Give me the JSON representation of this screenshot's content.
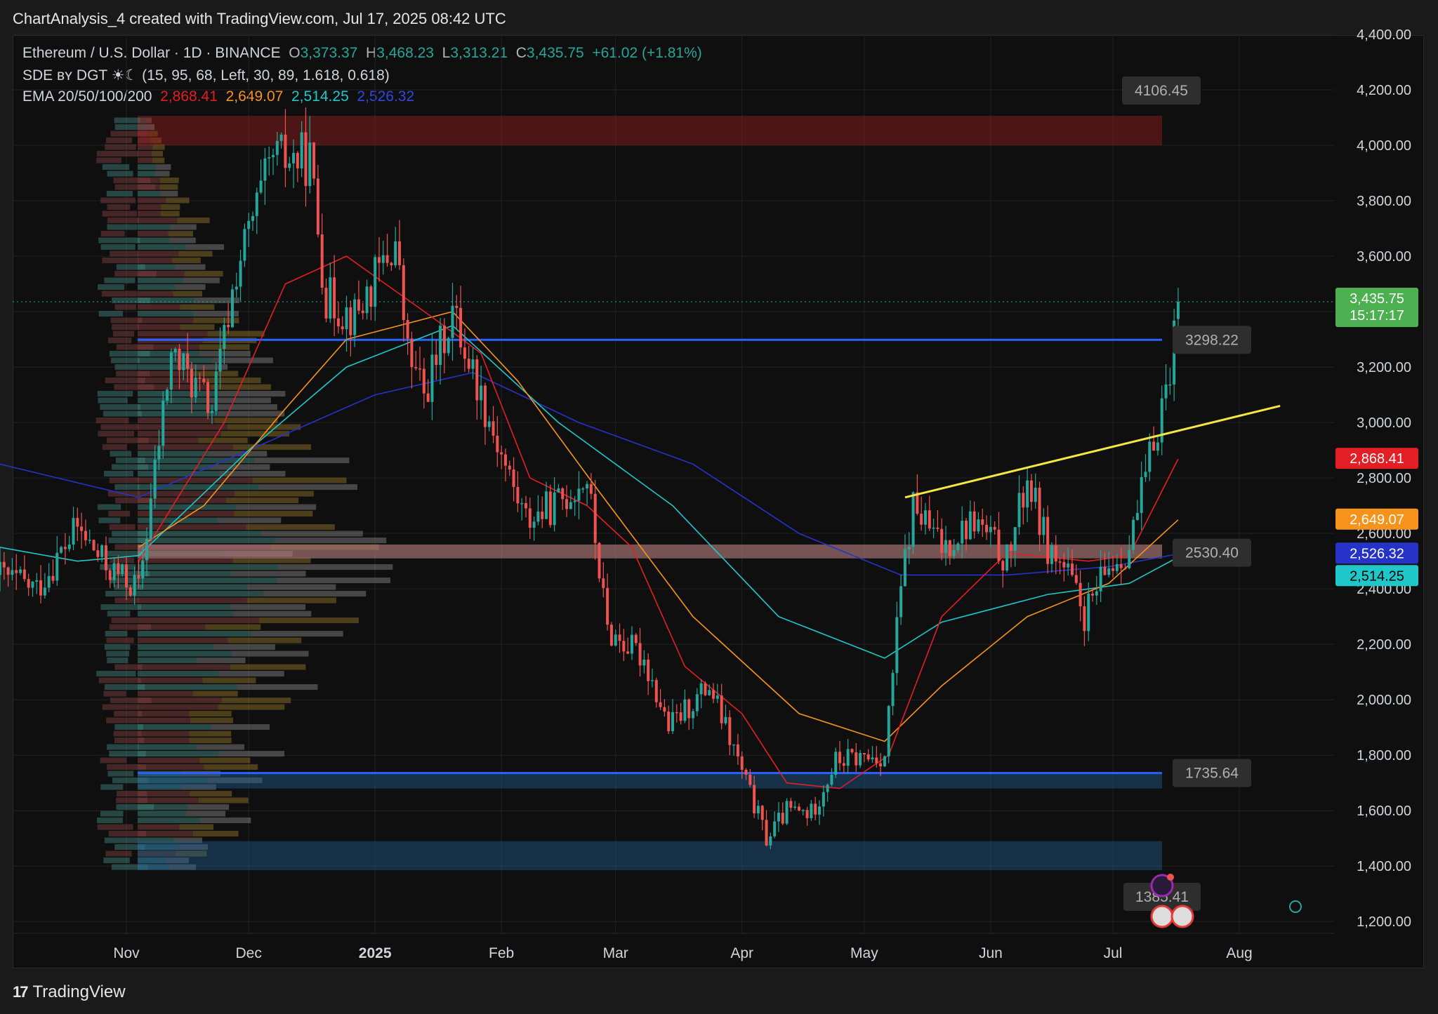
{
  "header": {
    "attribution": "ChartAnalysis_4 created with TradingView.com, Jul 17, 2025 08:42 UTC"
  },
  "legend": {
    "symbol": "Ethereum / U.S. Dollar · 1D · BINANCE",
    "open_label": "O",
    "open": "3,373.37",
    "high_label": "H",
    "high": "3,468.23",
    "low_label": "L",
    "low": "3,313.21",
    "close_label": "C",
    "close": "3,435.75",
    "change": "+61.02 (+1.81%)",
    "sde": "SDE ʙʏ DGT ☀☾ (15, 95, 68, Left, 30, 89, 1.618, 0.618)",
    "ema_label": "EMA 20/50/100/200",
    "ema20": "2,868.41",
    "ema50": "2,649.07",
    "ema100": "2,514.25",
    "ema200": "2,526.32"
  },
  "footer": {
    "brand": "TradingView",
    "logo": "17"
  },
  "colors": {
    "up": "#26a69a",
    "down": "#ef5350",
    "ema20": "#e31e24",
    "ema50": "#f7931a",
    "ema100": "#1ec8c8",
    "ema200": "#2633c9",
    "trendline": "#f5e642",
    "level": "#2962ff"
  },
  "chart_data": {
    "type": "candlestick",
    "title": "Ethereum / U.S. Dollar · 1D · BINANCE",
    "xlabel": "",
    "ylabel": "",
    "ylim": [
      1050,
      4500
    ],
    "x_ticks": [
      {
        "label": "Nov",
        "date": "2024-11-01"
      },
      {
        "label": "Dec",
        "date": "2024-12-01"
      },
      {
        "label": "2025",
        "date": "2025-01-01",
        "bold": true
      },
      {
        "label": "Feb",
        "date": "2025-02-01"
      },
      {
        "label": "Mar",
        "date": "2025-03-01"
      },
      {
        "label": "Apr",
        "date": "2025-04-01"
      },
      {
        "label": "May",
        "date": "2025-05-01"
      },
      {
        "label": "Jun",
        "date": "2025-06-01"
      },
      {
        "label": "Jul",
        "date": "2025-07-01"
      },
      {
        "label": "Aug",
        "date": "2025-08-01"
      }
    ],
    "y_ticks": [
      "1,200.00",
      "1,400.00",
      "1,600.00",
      "1,800.00",
      "2,000.00",
      "2,200.00",
      "2,400.00",
      "2,600.00",
      "2,800.00",
      "3,000.00",
      "3,200.00",
      "3,400.00",
      "3,600.00",
      "3,800.00",
      "4,000.00",
      "4,200.00",
      "4,400.00"
    ],
    "y_tick_values": [
      1200,
      1400,
      1600,
      1800,
      2000,
      2200,
      2400,
      2600,
      2800,
      3000,
      3200,
      3400,
      3600,
      3800,
      4000,
      4200,
      4400
    ],
    "last_price": {
      "value": 3435.75,
      "label": "3,435.75",
      "countdown": "15:17:17"
    },
    "ema_tags": [
      {
        "value": 2868.41,
        "label": "2,868.41",
        "color": "#e31e24"
      },
      {
        "value": 2649.07,
        "label": "2,649.07",
        "color": "#f7931a"
      },
      {
        "value": 2526.32,
        "label": "2,526.32",
        "color": "#2633c9"
      },
      {
        "value": 2514.25,
        "label": "2,514.25",
        "color": "#1ec8c8"
      }
    ],
    "zones": [
      {
        "from": 4000,
        "to": 4106.45,
        "label": "4106.45",
        "color": "red"
      },
      {
        "from": 2510,
        "to": 2560,
        "label": "2530.40",
        "color": "red"
      },
      {
        "from": 1680,
        "to": 1735.64,
        "label": "1735.64",
        "color": "blue"
      },
      {
        "from": 1385.41,
        "to": 1490,
        "label": "1385.41",
        "color": "blue"
      }
    ],
    "levels": [
      {
        "value": 3298.22,
        "label": "3298.22"
      },
      {
        "value": 1735.64,
        "label": "1735.64"
      }
    ],
    "trendline": {
      "start": {
        "date": "2025-05-11",
        "price": 2730
      },
      "end": {
        "date": "2025-08-11",
        "price": 3060
      }
    },
    "price_path": [
      [
        "2024-10-01",
        2450
      ],
      [
        "2024-10-10",
        2400
      ],
      [
        "2024-10-20",
        2620
      ],
      [
        "2024-10-27",
        2480
      ],
      [
        "2024-11-04",
        2400
      ],
      [
        "2024-11-12",
        3250
      ],
      [
        "2024-11-22",
        3050
      ],
      [
        "2024-11-28",
        3550
      ],
      [
        "2024-12-07",
        3950
      ],
      [
        "2024-12-16",
        3950
      ],
      [
        "2024-12-20",
        3450
      ],
      [
        "2024-12-27",
        3380
      ],
      [
        "2025-01-06",
        3650
      ],
      [
        "2025-01-09",
        3250
      ],
      [
        "2025-01-13",
        3100
      ],
      [
        "2025-01-20",
        3400
      ],
      [
        "2025-01-27",
        3100
      ],
      [
        "2025-02-03",
        2800
      ],
      [
        "2025-02-07",
        2650
      ],
      [
        "2025-02-14",
        2700
      ],
      [
        "2025-02-22",
        2800
      ],
      [
        "2025-02-27",
        2250
      ],
      [
        "2025-03-08",
        2150
      ],
      [
        "2025-03-14",
        1900
      ],
      [
        "2025-03-24",
        2050
      ],
      [
        "2025-03-30",
        1820
      ],
      [
        "2025-04-07",
        1500
      ],
      [
        "2025-04-12",
        1600
      ],
      [
        "2025-04-18",
        1590
      ],
      [
        "2025-04-24",
        1780
      ],
      [
        "2025-05-06",
        1800
      ],
      [
        "2025-05-10",
        2400
      ],
      [
        "2025-05-13",
        2700
      ],
      [
        "2025-05-20",
        2550
      ],
      [
        "2025-05-28",
        2650
      ],
      [
        "2025-06-05",
        2500
      ],
      [
        "2025-06-10",
        2800
      ],
      [
        "2025-06-15",
        2550
      ],
      [
        "2025-06-20",
        2450
      ],
      [
        "2025-06-24",
        2300
      ],
      [
        "2025-06-30",
        2480
      ],
      [
        "2025-07-05",
        2550
      ],
      [
        "2025-07-09",
        2800
      ],
      [
        "2025-07-12",
        3000
      ],
      [
        "2025-07-15",
        3200
      ],
      [
        "2025-07-17",
        3435.75
      ]
    ],
    "ema20_path": [
      [
        "2024-11-04",
        2500
      ],
      [
        "2024-11-25",
        3000
      ],
      [
        "2024-12-10",
        3500
      ],
      [
        "2024-12-25",
        3600
      ],
      [
        "2025-01-15",
        3380
      ],
      [
        "2025-01-27",
        3250
      ],
      [
        "2025-02-08",
        2800
      ],
      [
        "2025-02-22",
        2700
      ],
      [
        "2025-03-05",
        2550
      ],
      [
        "2025-03-18",
        2120
      ],
      [
        "2025-04-01",
        1950
      ],
      [
        "2025-04-12",
        1700
      ],
      [
        "2025-04-25",
        1680
      ],
      [
        "2025-05-07",
        1800
      ],
      [
        "2025-05-20",
        2300
      ],
      [
        "2025-06-05",
        2530
      ],
      [
        "2025-06-25",
        2500
      ],
      [
        "2025-07-05",
        2520
      ],
      [
        "2025-07-17",
        2868.41
      ]
    ],
    "ema50_path": [
      [
        "2024-11-04",
        2550
      ],
      [
        "2024-11-20",
        2700
      ],
      [
        "2024-12-10",
        3050
      ],
      [
        "2024-12-25",
        3300
      ],
      [
        "2025-01-20",
        3400
      ],
      [
        "2025-02-05",
        3150
      ],
      [
        "2025-02-25",
        2750
      ],
      [
        "2025-03-20",
        2300
      ],
      [
        "2025-04-15",
        1950
      ],
      [
        "2025-05-06",
        1850
      ],
      [
        "2025-05-20",
        2050
      ],
      [
        "2025-06-10",
        2300
      ],
      [
        "2025-06-30",
        2420
      ],
      [
        "2025-07-17",
        2649.07
      ]
    ],
    "ema100_path": [
      [
        "2024-10-01",
        2550
      ],
      [
        "2024-10-20",
        2500
      ],
      [
        "2024-11-04",
        2520
      ],
      [
        "2024-12-01",
        2900
      ],
      [
        "2024-12-25",
        3200
      ],
      [
        "2025-01-20",
        3350
      ],
      [
        "2025-02-15",
        3000
      ],
      [
        "2025-03-15",
        2700
      ],
      [
        "2025-04-10",
        2300
      ],
      [
        "2025-05-06",
        2150
      ],
      [
        "2025-05-20",
        2280
      ],
      [
        "2025-06-15",
        2380
      ],
      [
        "2025-07-05",
        2420
      ],
      [
        "2025-07-17",
        2514.25
      ]
    ],
    "ema200_path": [
      [
        "2024-10-01",
        2850
      ],
      [
        "2024-11-04",
        2730
      ],
      [
        "2024-12-01",
        2900
      ],
      [
        "2025-01-01",
        3100
      ],
      [
        "2025-01-25",
        3180
      ],
      [
        "2025-02-20",
        3000
      ],
      [
        "2025-03-20",
        2850
      ],
      [
        "2025-04-15",
        2600
      ],
      [
        "2025-05-10",
        2450
      ],
      [
        "2025-06-05",
        2450
      ],
      [
        "2025-06-30",
        2480
      ],
      [
        "2025-07-17",
        2526.32
      ]
    ]
  }
}
